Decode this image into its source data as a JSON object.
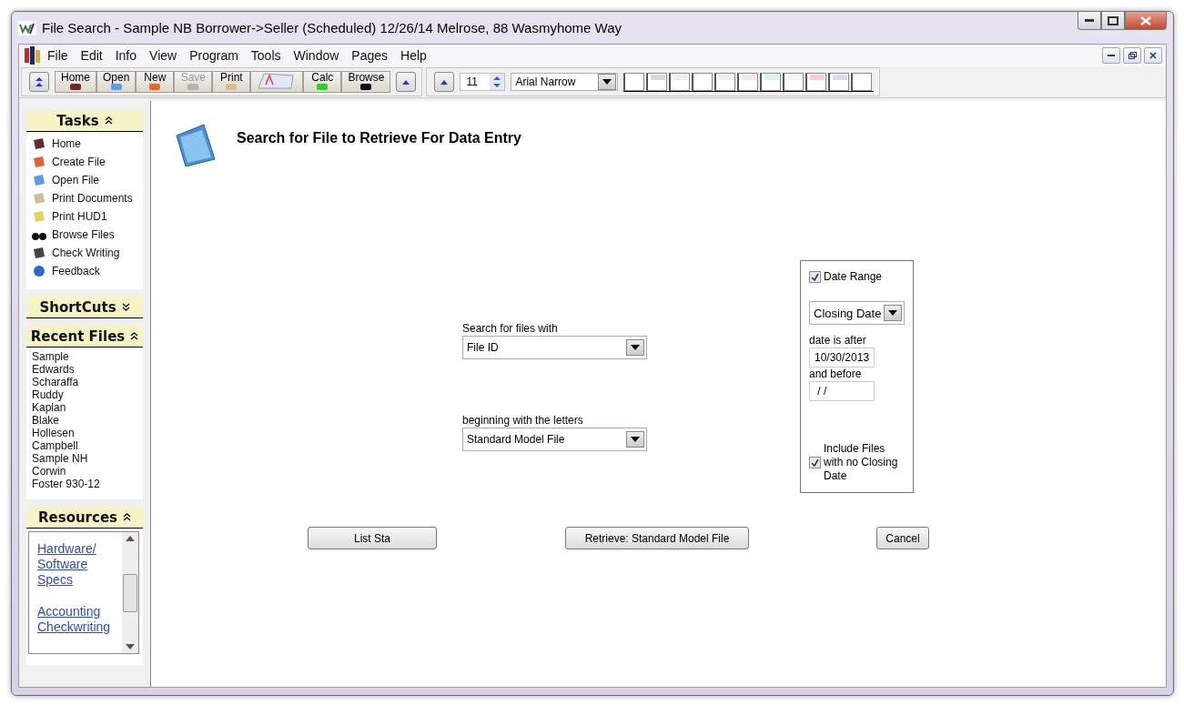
{
  "window": {
    "title": "File Search - Sample NB Borrower->Seller (Scheduled) 12/26/14 Melrose, 88 Wasmyhome Way"
  },
  "menu": [
    "File",
    "Edit",
    "Info",
    "View",
    "Program",
    "Tools",
    "Window",
    "Pages",
    "Help"
  ],
  "toolbar": {
    "buttons": [
      {
        "label": "Home",
        "kind": "home",
        "disabled": false
      },
      {
        "label": "Open",
        "kind": "open",
        "disabled": false
      },
      {
        "label": "New",
        "kind": "new",
        "disabled": false
      },
      {
        "label": "Save",
        "kind": "save",
        "disabled": true
      },
      {
        "label": "Print",
        "kind": "print",
        "disabled": false
      },
      {
        "label": "Calc",
        "kind": "calc",
        "disabled": false
      },
      {
        "label": "Browse",
        "kind": "browse",
        "disabled": false
      }
    ],
    "font_size": "11",
    "font_name": "Arial Narrow",
    "swatches": [
      {
        "color": "#ffffff"
      },
      {
        "color": "#d8d8d8"
      },
      {
        "color": "#eeeeee"
      },
      {
        "color": "#ffffff"
      },
      {
        "color": "#f0f0f0"
      },
      {
        "color": "#fbe4e4"
      },
      {
        "color": "#d8f5d8"
      },
      {
        "color": "#eef6f2"
      },
      {
        "color": "#f8d0d0"
      },
      {
        "color": "#d8d8f8"
      },
      {
        "color": "#ffffff"
      }
    ]
  },
  "sidebar": [
    {
      "title": "Tasks",
      "expanded": true,
      "kind": "tasks",
      "items": [
        {
          "label": "Home"
        },
        {
          "label": "Create File"
        },
        {
          "label": "Open File"
        },
        {
          "label": "Print Documents"
        },
        {
          "label": "Print HUD1"
        },
        {
          "label": "Browse Files"
        },
        {
          "label": "Check Writing"
        },
        {
          "label": "Feedback"
        }
      ]
    },
    {
      "title": "ShortCuts",
      "expanded": false
    },
    {
      "title": "Recent Files",
      "expanded": true,
      "kind": "recent",
      "items": [
        {
          "label": "Sample"
        },
        {
          "label": "Edwards"
        },
        {
          "label": "Scharaffa"
        },
        {
          "label": "Ruddy"
        },
        {
          "label": "Kaplan"
        },
        {
          "label": "Blake"
        },
        {
          "label": "Hollesen"
        },
        {
          "label": "Campbell"
        },
        {
          "label": "Sample NH"
        },
        {
          "label": "Corwin"
        },
        {
          "label": "Foster 930-12"
        }
      ]
    },
    {
      "title": "Resources",
      "expanded": true,
      "kind": "links",
      "items": [
        {
          "label": "Hardware/ Software Specs"
        },
        {
          "label": "Accounting Checkwriting"
        }
      ]
    }
  ],
  "content": {
    "heading": "Search for File to Retrieve For Data Entry",
    "search_label": "Search for files with",
    "search_value": "File ID",
    "letters_label": "beginning with the letters",
    "letters_value": "Standard Model File",
    "date_range": {
      "label": "Date Range",
      "checked": true,
      "date_type": "Closing Date",
      "after_label": "date is after",
      "after_value": "10/30/2013",
      "before_label": "and before",
      "before_value": " / /",
      "include_label": "Include Files with no Closing Date",
      "include_checked": true
    },
    "buttons": [
      "List Sta",
      "Retrieve: Standard Model File",
      "Cancel"
    ]
  }
}
